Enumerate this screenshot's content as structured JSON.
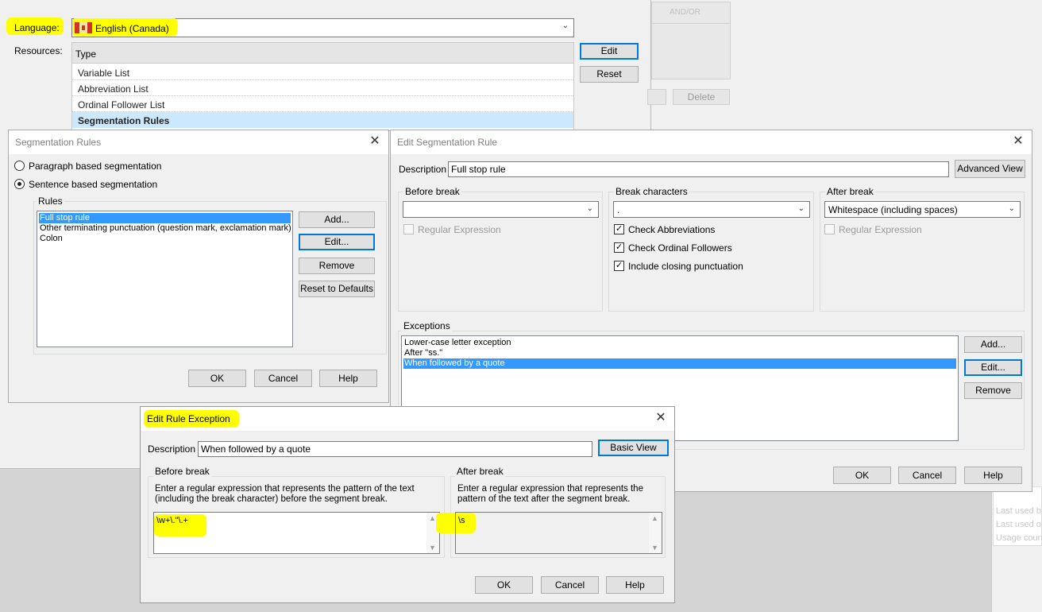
{
  "background_window": {
    "language_label": "Language:",
    "language_value": "English (Canada)",
    "resources_label": "Resources:",
    "type_header": "Type",
    "resource_types": [
      "Variable List",
      "Abbreviation List",
      "Ordinal Follower List",
      "Segmentation Rules"
    ],
    "edit_button": "Edit",
    "reset_button": "Reset",
    "andor_header": "AND/OR",
    "delete_button": "Delete",
    "right_partial_items": [
      "Last used b",
      "Last used o",
      "Usage coun"
    ]
  },
  "segmentation_rules": {
    "title": "Segmentation Rules",
    "radio_paragraph": "Paragraph based segmentation",
    "radio_sentence": "Sentence based segmentation",
    "rules_group": "Rules",
    "rules": [
      "Full stop rule",
      "Other terminating punctuation (question mark, exclamation mark)",
      "Colon"
    ],
    "add_button": "Add...",
    "edit_button": "Edit...",
    "remove_button": "Remove",
    "reset_defaults_button": "Reset to Defaults",
    "ok_button": "OK",
    "cancel_button": "Cancel",
    "help_button": "Help"
  },
  "edit_segmentation_rule": {
    "title": "Edit Segmentation Rule",
    "description_label": "Description",
    "description_value": "Full stop rule",
    "advanced_view_button": "Advanced View",
    "before_break_group": "Before break",
    "before_break_value": "",
    "before_regex_label": "Regular Expression",
    "break_chars_group": "Break characters",
    "break_chars_value": ".",
    "check_abbreviations": "Check Abbreviations",
    "check_ordinal": "Check Ordinal Followers",
    "include_closing": "Include closing punctuation",
    "after_break_group": "After break",
    "after_break_value": "Whitespace (including spaces)",
    "after_regex_label": "Regular Expression",
    "exceptions_group": "Exceptions",
    "exceptions": [
      "Lower-case letter exception",
      "After \"ss.\"",
      "When followed by a quote"
    ],
    "add_button": "Add...",
    "edit_button": "Edit...",
    "remove_button": "Remove",
    "ok_button": "OK",
    "cancel_button": "Cancel",
    "help_button": "Help"
  },
  "edit_rule_exception": {
    "title": "Edit Rule Exception",
    "description_label": "Description",
    "description_value": "When followed by a quote",
    "basic_view_button": "Basic View",
    "before_break_group": "Before break",
    "before_break_help": "Enter a regular expression that represents the pattern of the text (including the break character) before the segment break.",
    "before_break_regex": "\\w+\\.\"\\.+",
    "after_break_group": "After break",
    "after_break_help": "Enter a regular expression that represents the pattern of the text after the segment break.",
    "after_break_regex": "\\s",
    "ok_button": "OK",
    "cancel_button": "Cancel",
    "help_button": "Help"
  },
  "colors": {
    "highlight": "#ffff00",
    "selection": "#3399ff",
    "accent": "#0078d7"
  }
}
